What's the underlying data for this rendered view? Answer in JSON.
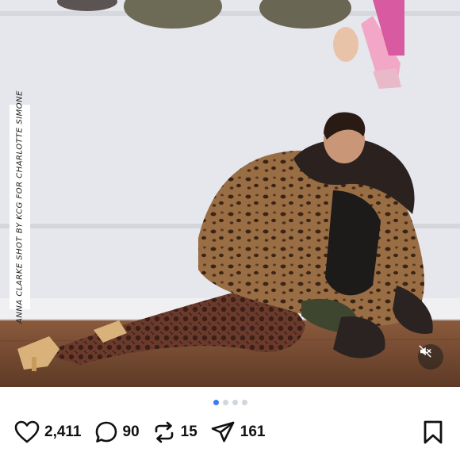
{
  "post": {
    "photo_caption": "ANNA CLARKE SHOT BY KCG FOR CHARLOTTE SIMONE",
    "carousel": {
      "total": 4,
      "active": 1
    },
    "mute_button": {
      "icon": "muted-speaker-icon",
      "state": "muted"
    },
    "actions": {
      "likes": "2,411",
      "comments": "90",
      "reposts": "15",
      "shares": "161"
    },
    "icons": {
      "like": "heart-icon",
      "comment": "comment-bubble-icon",
      "repost": "repost-arrows-icon",
      "share": "send-icon",
      "bookmark": "bookmark-icon"
    },
    "colors": {
      "active_dot": "#3a7bf4",
      "inactive_dot": "#d2d5db",
      "text": "#111111"
    }
  }
}
